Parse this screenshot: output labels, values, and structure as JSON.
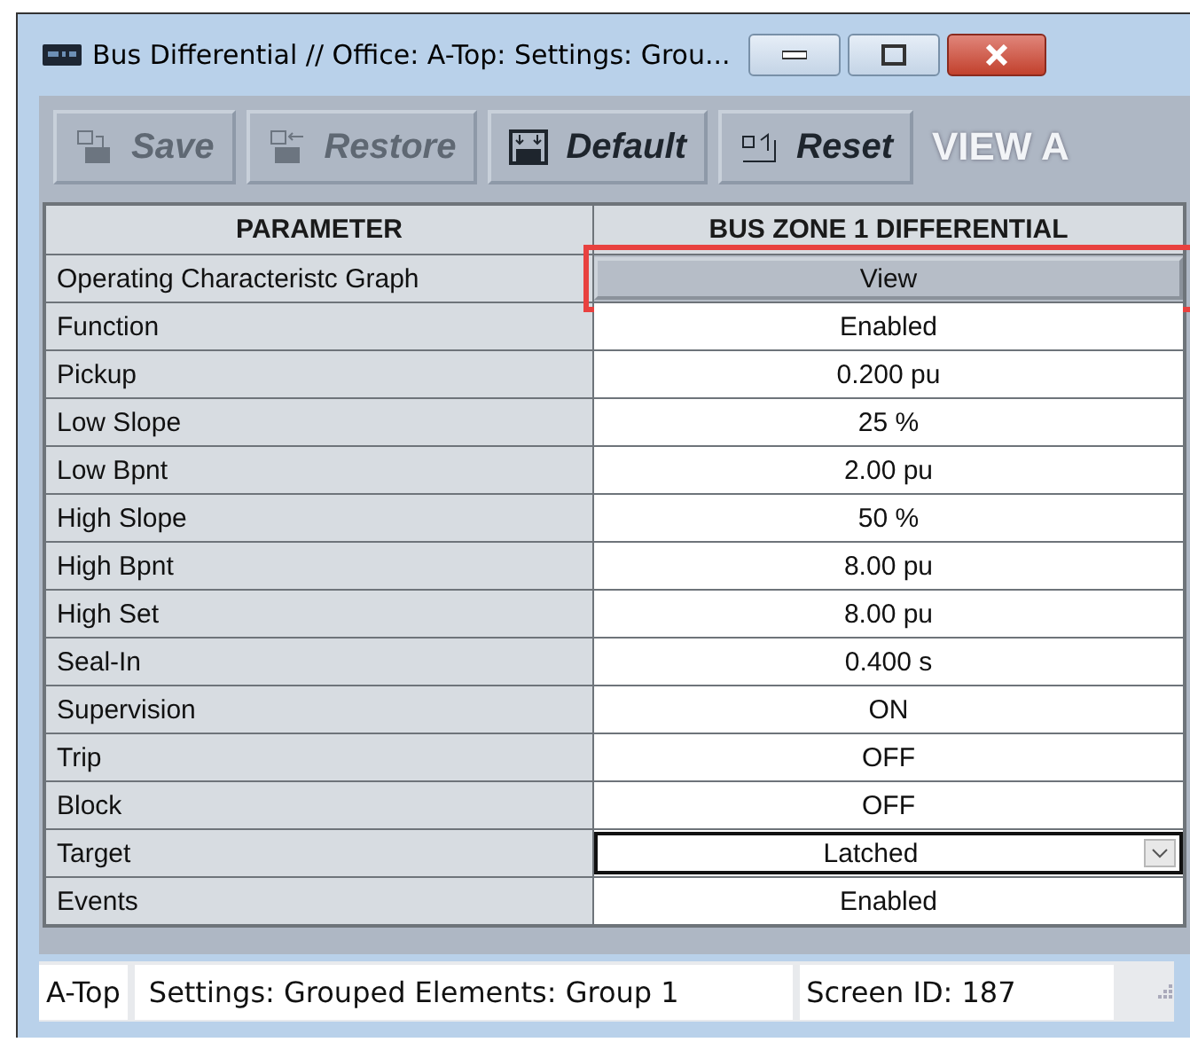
{
  "window": {
    "title": "Bus Differential // Office: A-Top: Settings: Grou..."
  },
  "toolbar": {
    "buttons": [
      {
        "label": "Save",
        "kind": "save",
        "disabled": true
      },
      {
        "label": "Restore",
        "kind": "restore",
        "disabled": true
      },
      {
        "label": "Default",
        "kind": "default",
        "disabled": false
      },
      {
        "label": "Reset",
        "kind": "reset",
        "disabled": false
      }
    ],
    "banner": "VIEW A"
  },
  "table": {
    "columns": [
      "PARAMETER",
      "BUS ZONE 1 DIFFERENTIAL"
    ],
    "rows": [
      {
        "parameter": "Operating Characteristc Graph",
        "value": "View",
        "kind": "button",
        "highlighted": true
      },
      {
        "parameter": "Function",
        "value": "Enabled",
        "kind": "text",
        "highlighted": false
      },
      {
        "parameter": "Pickup",
        "value": "0.200 pu",
        "kind": "text",
        "highlighted": false
      },
      {
        "parameter": "Low Slope",
        "value": "25 %",
        "kind": "text",
        "highlighted": false
      },
      {
        "parameter": "Low Bpnt",
        "value": "2.00 pu",
        "kind": "text",
        "highlighted": false
      },
      {
        "parameter": "High Slope",
        "value": "50 %",
        "kind": "text",
        "highlighted": false
      },
      {
        "parameter": "High Bpnt",
        "value": "8.00 pu",
        "kind": "text",
        "highlighted": false
      },
      {
        "parameter": "High Set",
        "value": "8.00 pu",
        "kind": "text",
        "highlighted": false
      },
      {
        "parameter": "Seal-In",
        "value": "0.400 s",
        "kind": "text",
        "highlighted": false
      },
      {
        "parameter": "Supervision",
        "value": "ON",
        "kind": "text",
        "highlighted": false
      },
      {
        "parameter": "Trip",
        "value": "OFF",
        "kind": "text",
        "highlighted": false
      },
      {
        "parameter": "Block",
        "value": "OFF",
        "kind": "text",
        "highlighted": false
      },
      {
        "parameter": "Target",
        "value": "Latched",
        "kind": "dropdown",
        "highlighted": false
      },
      {
        "parameter": "Events",
        "value": "Enabled",
        "kind": "text",
        "highlighted": false
      }
    ]
  },
  "status_bar": [
    "A-Top",
    "Settings: Grouped Elements: Group 1",
    "Screen ID: 187"
  ]
}
